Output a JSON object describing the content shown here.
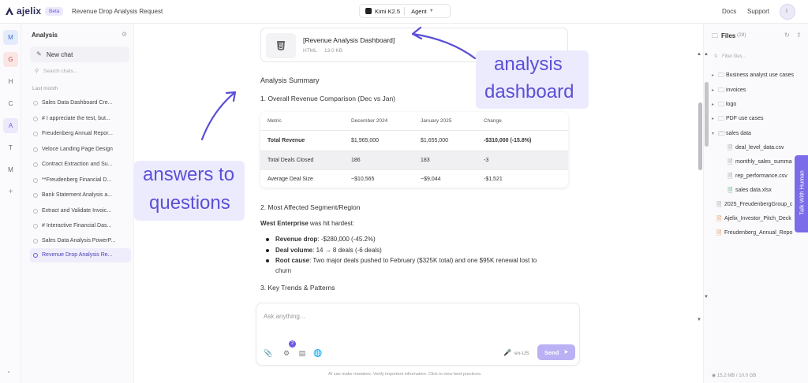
{
  "app": {
    "name": "ajelix",
    "badge": "Beta",
    "chat_title": "Revenue Drop Analysis Request"
  },
  "header": {
    "model": "Kimi K2.5",
    "mode": "Agent",
    "docs": "Docs",
    "support": "Support",
    "avatar_initial": "I"
  },
  "rail": {
    "items": [
      "M",
      "G",
      "H",
      "C",
      "A",
      "T",
      "M",
      "+"
    ]
  },
  "sidebar": {
    "title": "Analysis",
    "new_chat": "New chat",
    "search_placeholder": "Search chats...",
    "section": "Last month",
    "chats": [
      "Sales Data Dashboard Cre...",
      "# I appreciate the test, but...",
      "Freudenberg Annual Repor...",
      "Veloce Landing Page Design",
      "Contract Extraction and Su...",
      "**Freudenberg Financial D...",
      "Bank Statement Analysis a...",
      "Extract and Validate Invoic...",
      "# Interactive Financial Das...",
      "Sales Data Analysis PowerP...",
      "Revenue Drop Analysis Re..."
    ]
  },
  "file_card": {
    "name": "[Revenue Analysis Dashboard]",
    "type": "HTML",
    "size": "13.0 KB"
  },
  "content": {
    "summary_heading": "Analysis Summary",
    "section1": "1. Overall Revenue Comparison (Dec vs Jan)",
    "table": {
      "headers": [
        "Metric",
        "December 2024",
        "January 2025",
        "Change"
      ],
      "rows": [
        [
          "Total Revenue",
          "$1,965,000",
          "$1,655,000",
          "-$310,000 (-15.8%)"
        ],
        [
          "Total Deals Closed",
          "186",
          "183",
          "-3"
        ],
        [
          "Average Deal Size",
          "~$10,565",
          "~$9,044",
          "-$1,521"
        ]
      ]
    },
    "section2": "2. Most Affected Segment/Region",
    "segment_bold": "West Enterprise",
    "segment_rest": " was hit hardest:",
    "bullets": [
      {
        "label": "Revenue drop",
        "text": ": -$280,000 (-45.2%)"
      },
      {
        "label": "Deal volume",
        "text": ": 14 → 8 deals (-6 deals)"
      },
      {
        "label": "Root cause",
        "text": ": Two major deals pushed to February ($325K total) and one $95K renewal lost to"
      }
    ],
    "bullet_cont": "churn",
    "section3": "3. Key Trends & Patterns"
  },
  "input": {
    "placeholder": "Ask anything...",
    "badge_count": "2",
    "lang": "en-US",
    "send": "Send",
    "disclaimer": "AI can make mistakes. Verify important information. Click to view best practices."
  },
  "files": {
    "title": "Files",
    "count": "(28)",
    "filter_placeholder": "Filter files...",
    "folders": [
      "Business analyst use cases",
      "invoices",
      "logo",
      "PDF use cases",
      "sales data"
    ],
    "sales_files": [
      "deal_level_data.csv",
      "monthly_sales_summa",
      "rep_performance.csv",
      "sales data.xlsx"
    ],
    "root_files": [
      "2025_FreudenbergGroup_c",
      "Ajelix_Investor_Pitch_Deck",
      "Freudenberg_Annual_Repo"
    ],
    "storage": "15.2 MB / 10.0 GB"
  },
  "talk_tab": "Talk With Human",
  "annotations": {
    "top": [
      "analysis",
      "dashboard"
    ],
    "left": [
      "answers to",
      "questions"
    ]
  },
  "colors": {
    "accent": "#6a5ae0",
    "annotation": "#5b4fd6",
    "talk_tab": "#7b6ce9"
  }
}
